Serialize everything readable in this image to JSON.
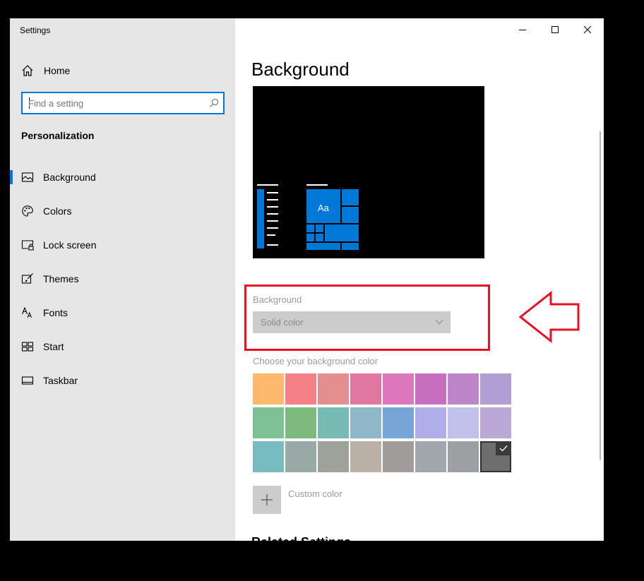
{
  "window": {
    "app_title": "Settings",
    "controls": {
      "minimize": "minimize-icon",
      "maximize": "maximize-icon",
      "close": "close-icon"
    }
  },
  "sidebar": {
    "home": {
      "label": "Home",
      "icon": "home-icon"
    },
    "search": {
      "placeholder": "Find a setting",
      "value": "",
      "icon": "search-icon"
    },
    "section_label": "Personalization",
    "items": [
      {
        "label": "Background",
        "icon": "picture-icon",
        "selected": true
      },
      {
        "label": "Colors",
        "icon": "palette-icon",
        "selected": false
      },
      {
        "label": "Lock screen",
        "icon": "lock-screen-icon",
        "selected": false
      },
      {
        "label": "Themes",
        "icon": "brush-icon",
        "selected": false
      },
      {
        "label": "Fonts",
        "icon": "fonts-icon",
        "selected": false
      },
      {
        "label": "Start",
        "icon": "start-icon",
        "selected": false
      },
      {
        "label": "Taskbar",
        "icon": "taskbar-icon",
        "selected": false
      }
    ]
  },
  "main": {
    "title": "Background",
    "preview": {
      "sample_text": "Aa"
    },
    "background_field": {
      "label": "Background",
      "value": "Solid color"
    },
    "color_picker": {
      "label": "Choose your background color",
      "rows": [
        [
          "#ffb96e",
          "#f38185",
          "#e48f8f",
          "#df77a1",
          "#df77bd",
          "#c86ebe",
          "#bf85c9",
          "#b29ed3"
        ],
        [
          "#7ec194",
          "#7eb97e",
          "#78bab4",
          "#8eb7c8",
          "#77a6d6",
          "#afaee8",
          "#c2c1ec",
          "#bca8d6"
        ],
        [
          "#77bcc0",
          "#99aaa6",
          "#9fa29a",
          "#bbb1a6",
          "#9f9c9a",
          "#a2a7ae",
          "#9ca0a2",
          "#6e6e6e"
        ]
      ],
      "selected": {
        "row": 2,
        "col": 7
      }
    },
    "custom_color": {
      "label": "Custom color",
      "icon": "plus-icon"
    },
    "related_heading": "Related Settings"
  },
  "colors": {
    "accent": "#0078d7",
    "sidebar_bg": "#e6e6e6",
    "annotation": "#e81123"
  }
}
